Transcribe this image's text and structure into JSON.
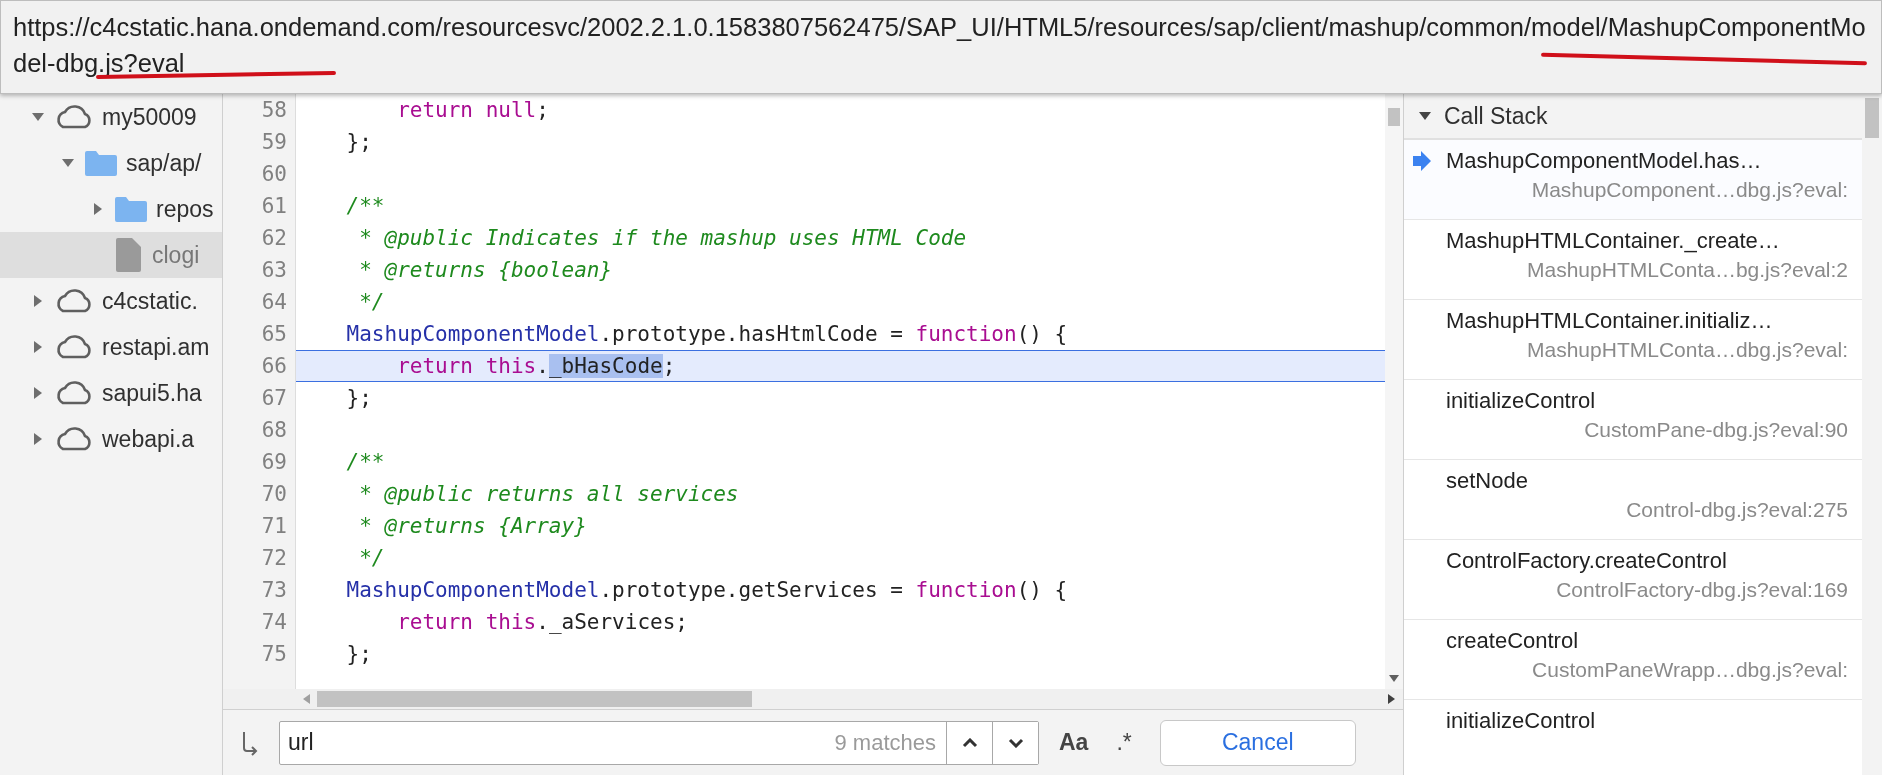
{
  "tooltip": {
    "text": "https://c4cstatic.hana.ondemand.com/resourcesvc/2002.2.1.0.1583807562475/SAP_UI/HTML5/resources/sap/client/mashup/common/model/MashupComponentModel-dbg.js?eval"
  },
  "sidebar": {
    "items": [
      {
        "label": "my50009",
        "kind": "domain",
        "expanded": true,
        "selected": false,
        "children": [
          {
            "label": "sap/ap/",
            "kind": "folder",
            "expanded": true,
            "selected": false,
            "children": [
              {
                "label": "repos",
                "kind": "folder",
                "expanded": false,
                "selected": false
              },
              {
                "label": "clogi",
                "kind": "file",
                "selected": true
              }
            ]
          }
        ]
      },
      {
        "label": "c4cstatic.",
        "kind": "domain",
        "expanded": false,
        "selected": false
      },
      {
        "label": "restapi.am",
        "kind": "domain",
        "expanded": false,
        "selected": false
      },
      {
        "label": "sapui5.ha",
        "kind": "domain",
        "expanded": false,
        "selected": false
      },
      {
        "label": "webapi.a",
        "kind": "domain",
        "expanded": false,
        "selected": false
      }
    ]
  },
  "editor": {
    "lines": [
      {
        "number": "58",
        "selected": false,
        "tokens": [
          {
            "kind": "keyword",
            "text": "        return"
          },
          {
            "kind": "keyword",
            "text": " null"
          },
          {
            "kind": "plain",
            "text": ";"
          }
        ]
      },
      {
        "number": "59",
        "selected": false,
        "tokens": [
          {
            "kind": "plain",
            "text": "    };"
          }
        ]
      },
      {
        "number": "60",
        "selected": false
      },
      {
        "number": "61",
        "selected": false,
        "tokens": [
          {
            "kind": "comment",
            "text": "    /**"
          }
        ]
      },
      {
        "number": "62",
        "selected": false,
        "tokens": [
          {
            "kind": "comment",
            "text": "     * @public Indicates if the mashup uses HTML Code"
          }
        ]
      },
      {
        "number": "63",
        "selected": false,
        "tokens": [
          {
            "kind": "comment",
            "text": "     * @returns {boolean}"
          }
        ]
      },
      {
        "number": "64",
        "selected": false,
        "tokens": [
          {
            "kind": "comment",
            "text": "     */"
          }
        ]
      },
      {
        "number": "65",
        "selected": false,
        "tokens": [
          {
            "kind": "type",
            "text": "    MashupComponentModel"
          },
          {
            "kind": "plain",
            "text": ".prototype.hasHtmlCode = "
          },
          {
            "kind": "keyword",
            "text": "function"
          },
          {
            "kind": "plain",
            "text": "() {"
          }
        ]
      },
      {
        "number": "66",
        "selected": true,
        "tokens": [
          {
            "kind": "keyword",
            "text": "        return"
          },
          {
            "kind": "keyword",
            "text": " this"
          },
          {
            "kind": "plain",
            "text": "."
          },
          {
            "kind": "match",
            "text": "_bHasCode"
          },
          {
            "kind": "plain",
            "text": ";"
          }
        ]
      },
      {
        "number": "67",
        "selected": false,
        "tokens": [
          {
            "kind": "plain",
            "text": "    };"
          }
        ]
      },
      {
        "number": "68",
        "selected": false
      },
      {
        "number": "69",
        "selected": false,
        "tokens": [
          {
            "kind": "comment",
            "text": "    /**"
          }
        ]
      },
      {
        "number": "70",
        "selected": false,
        "tokens": [
          {
            "kind": "comment",
            "text": "     * @public returns all services"
          }
        ]
      },
      {
        "number": "71",
        "selected": false,
        "tokens": [
          {
            "kind": "comment",
            "text": "     * @returns {Array}"
          }
        ]
      },
      {
        "number": "72",
        "selected": false,
        "tokens": [
          {
            "kind": "comment",
            "text": "     */"
          }
        ]
      },
      {
        "number": "73",
        "selected": false,
        "tokens": [
          {
            "kind": "type",
            "text": "    MashupComponentModel"
          },
          {
            "kind": "plain",
            "text": ".prototype.getServices = "
          },
          {
            "kind": "keyword",
            "text": "function"
          },
          {
            "kind": "plain",
            "text": "() {"
          }
        ]
      },
      {
        "number": "74",
        "selected": false,
        "tokens": [
          {
            "kind": "keyword",
            "text": "        return"
          },
          {
            "kind": "keyword",
            "text": " this"
          },
          {
            "kind": "plain",
            "text": "._aServices;"
          }
        ]
      },
      {
        "number": "75",
        "selected": false,
        "tokens": [
          {
            "kind": "plain",
            "text": "    };"
          }
        ]
      }
    ]
  },
  "search": {
    "value": "url",
    "matches": "9 matches",
    "case_button": "Aa",
    "regex_button": ".*",
    "cancel": "Cancel"
  },
  "call_stack": {
    "title": "Call Stack",
    "expanded": true,
    "frames": [
      {
        "name": "MashupComponentModel.has…",
        "location": "MashupComponent…dbg.js?eval:",
        "selected": true
      },
      {
        "name": "MashupHTMLContainer._create…",
        "location": "MashupHTMLConta…bg.js?eval:2",
        "selected": false
      },
      {
        "name": "MashupHTMLContainer.initializ…",
        "location": "MashupHTMLConta…dbg.js?eval:",
        "selected": false
      },
      {
        "name": "initializeControl",
        "location": "CustomPane-dbg.js?eval:90",
        "selected": false
      },
      {
        "name": "setNode",
        "location": "Control-dbg.js?eval:275",
        "selected": false
      },
      {
        "name": "ControlFactory.createControl",
        "location": "ControlFactory-dbg.js?eval:169",
        "selected": false
      },
      {
        "name": "createControl",
        "location": "CustomPaneWrapp…dbg.js?eval:",
        "selected": false
      },
      {
        "name": "initializeControl",
        "selected": false
      }
    ]
  }
}
